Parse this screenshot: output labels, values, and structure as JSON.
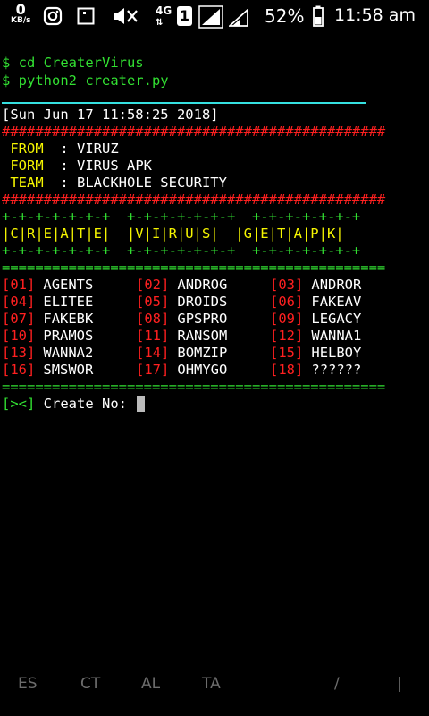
{
  "status_bar": {
    "speed_value": "0",
    "speed_unit": "KB/s",
    "network_type": "4G",
    "sim_slot": "1",
    "battery": "52%",
    "time": "11:58 am"
  },
  "terminal": {
    "commands": [
      "$ cd CreaterVirus",
      "$ python2 creater.py"
    ],
    "timestamp": "[Sun Jun 17 11:58:25 2018]",
    "hash_line": "##############################################",
    "info": [
      {
        "label": " FROM  ",
        "value": ": VIRUZ"
      },
      {
        "label": " FORM  ",
        "value": ": VIRUS APK"
      },
      {
        "label": " TEAM  ",
        "value": ": BLACKHOLE SECURITY"
      }
    ],
    "banner_border": "+-+-+-+-+-+-+  +-+-+-+-+-+-+  +-+-+-+-+-+-+",
    "banner_text": "|C|R|E|A|T|E|  |V|I|R|U|S|  |G|E|T|A|P|K|",
    "separator": "==============================================",
    "options": [
      {
        "num": "01",
        "name": "AGENTS"
      },
      {
        "num": "02",
        "name": "ANDROG"
      },
      {
        "num": "03",
        "name": "ANDROR"
      },
      {
        "num": "04",
        "name": "ELITEE"
      },
      {
        "num": "05",
        "name": "DROIDS"
      },
      {
        "num": "06",
        "name": "FAKEAV"
      },
      {
        "num": "07",
        "name": "FAKEBK"
      },
      {
        "num": "08",
        "name": "GPSPRO"
      },
      {
        "num": "09",
        "name": "LEGACY"
      },
      {
        "num": "10",
        "name": "PRAMOS"
      },
      {
        "num": "11",
        "name": "RANSOM"
      },
      {
        "num": "12",
        "name": "WANNA1"
      },
      {
        "num": "13",
        "name": "WANNA2"
      },
      {
        "num": "14",
        "name": "BOMZIP"
      },
      {
        "num": "15",
        "name": "HELBOY"
      },
      {
        "num": "16",
        "name": "SMSWOR"
      },
      {
        "num": "17",
        "name": "OHMYGO"
      },
      {
        "num": "18",
        "name": "??????"
      }
    ],
    "prompt_symbol": "[><]",
    "prompt_text": " Create No: "
  },
  "extra_keys": [
    "ES",
    "CT",
    "AL",
    "TA",
    "/",
    "|"
  ]
}
